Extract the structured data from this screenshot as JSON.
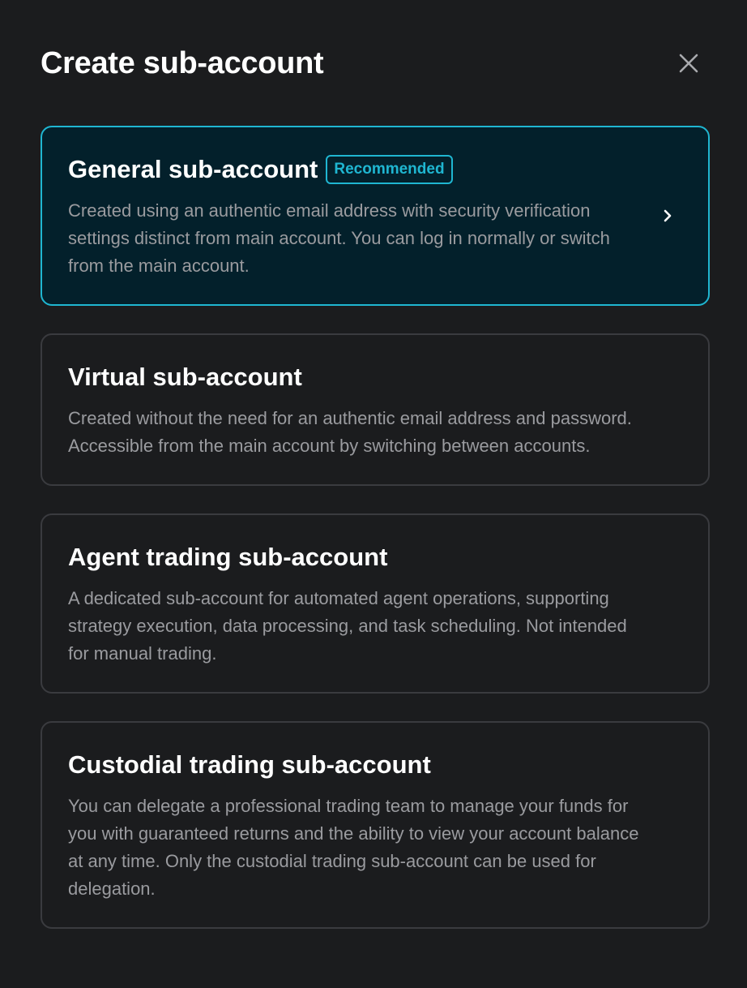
{
  "header": {
    "title": "Create sub-account"
  },
  "icons": {
    "close": "close-icon",
    "chevron": "chevron-right-icon"
  },
  "colors": {
    "background": "#1b1c1e",
    "accent": "#1fb6d1",
    "selected_card_bg": "#03202b",
    "card_border": "#3a3b3f",
    "description_text": "#9a9b9f"
  },
  "options": [
    {
      "title": "General sub-account",
      "badge": "Recommended",
      "description": "Created using an authentic email address with security verification settings distinct from main account. You can log in normally or switch from the main account.",
      "selected": true
    },
    {
      "title": "Virtual sub-account",
      "description": "Created without the need for an authentic email address and password. Accessible from the main account by switching between accounts."
    },
    {
      "title": "Agent trading sub-account",
      "description": "A dedicated sub-account for automated agent operations, supporting strategy execution, data processing, and task scheduling. Not intended for manual trading."
    },
    {
      "title": "Custodial trading sub-account",
      "description": "You can delegate a professional trading team to manage your funds for you with guaranteed returns and the ability to view your account balance at any time. Only the custodial trading sub-account can be used for delegation."
    }
  ]
}
